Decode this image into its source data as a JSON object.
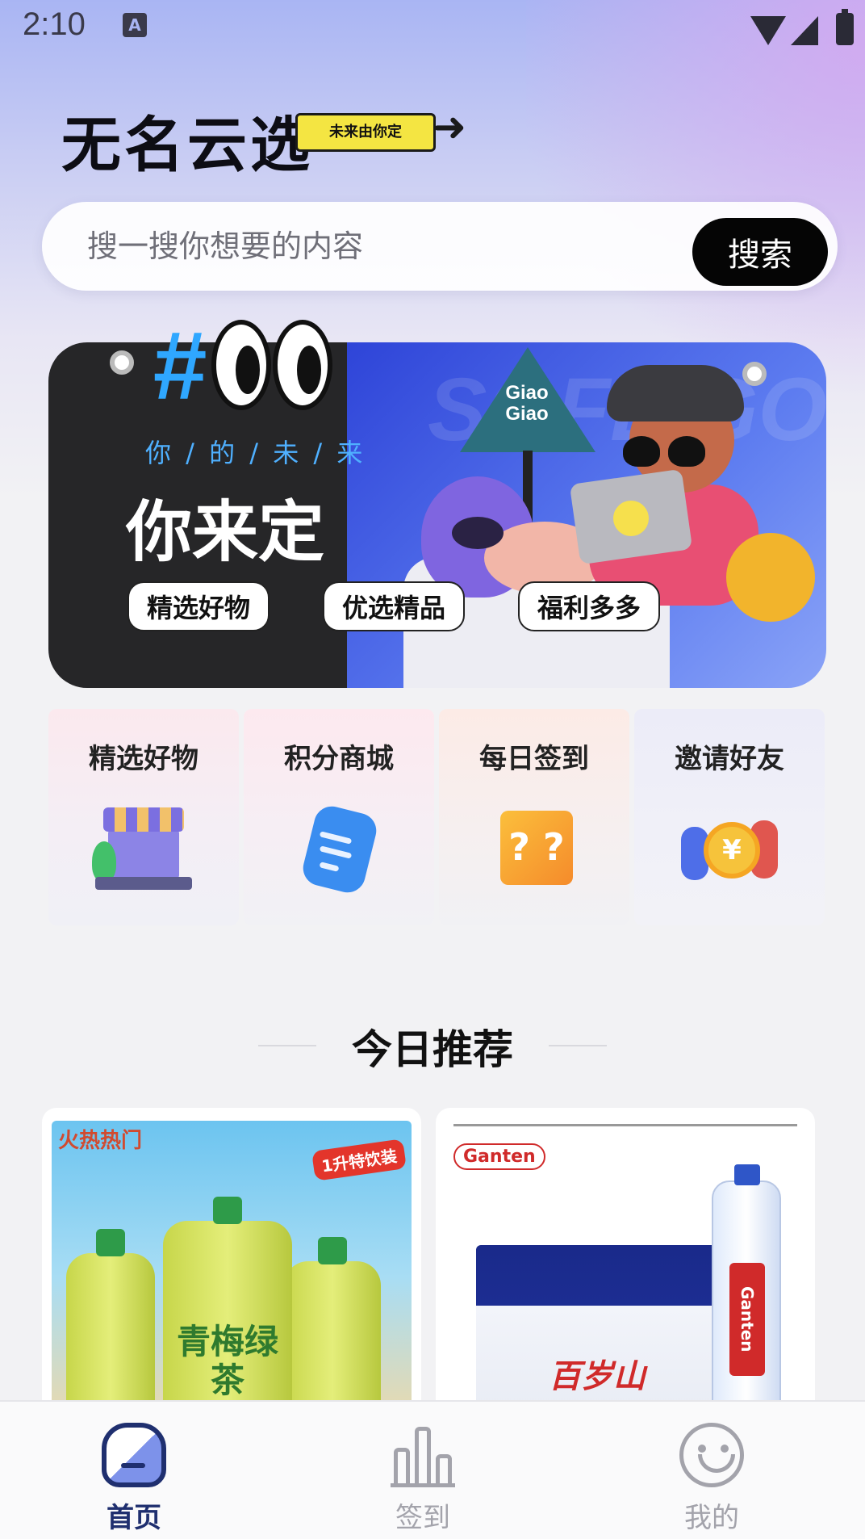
{
  "status_bar": {
    "time": "2:10",
    "app_indicator": "A",
    "icons": [
      "wifi-icon",
      "cell-signal-icon",
      "battery-icon"
    ]
  },
  "header": {
    "app_title": "无名云选",
    "slogan": "未来由你定",
    "slogan_icon": "arrow-right-icon"
  },
  "search": {
    "placeholder": "搜一搜你想要的内容",
    "value": "",
    "button_label": "搜索"
  },
  "banner": {
    "logo_text": "#",
    "background_text": "SOFLIGOD",
    "subtitle": "你 / 的 / 未 / 来",
    "title": "你来定",
    "sign_text": "Giao Giao",
    "chips": [
      "精选好物",
      "优选精品",
      "福利多多"
    ],
    "colors": {
      "left_panel": "#262628",
      "right_panel": "#2e44d8",
      "accent": "#2fa7ff"
    }
  },
  "quick_menu": {
    "items": [
      {
        "label": "精选好物",
        "icon": "storefront-icon"
      },
      {
        "label": "积分商城",
        "icon": "clipboard-icon"
      },
      {
        "label": "每日签到",
        "icon": "mystery-box-icon"
      },
      {
        "label": "邀请好友",
        "icon": "coin-friends-icon"
      }
    ]
  },
  "recommend": {
    "title": "今日推荐",
    "products": [
      {
        "corner_text": "火热热门",
        "tag": "1升特饮装",
        "bottle_text": "青梅绿茶",
        "image_desc_icon": "green-tea-bottles-image"
      },
      {
        "brand": "Ganten",
        "box_text": "百岁山",
        "bottle_text": "Ganten",
        "image_desc_icon": "mineral-water-box-image"
      }
    ]
  },
  "tab_bar": {
    "tabs": [
      {
        "label": "首页",
        "icon": "home-icon",
        "active": true
      },
      {
        "label": "签到",
        "icon": "bar-chart-icon",
        "active": false
      },
      {
        "label": "我的",
        "icon": "smiley-face-icon",
        "active": false
      }
    ],
    "active_color": "#1f2f6f",
    "inactive_color": "#a3a3ab"
  }
}
